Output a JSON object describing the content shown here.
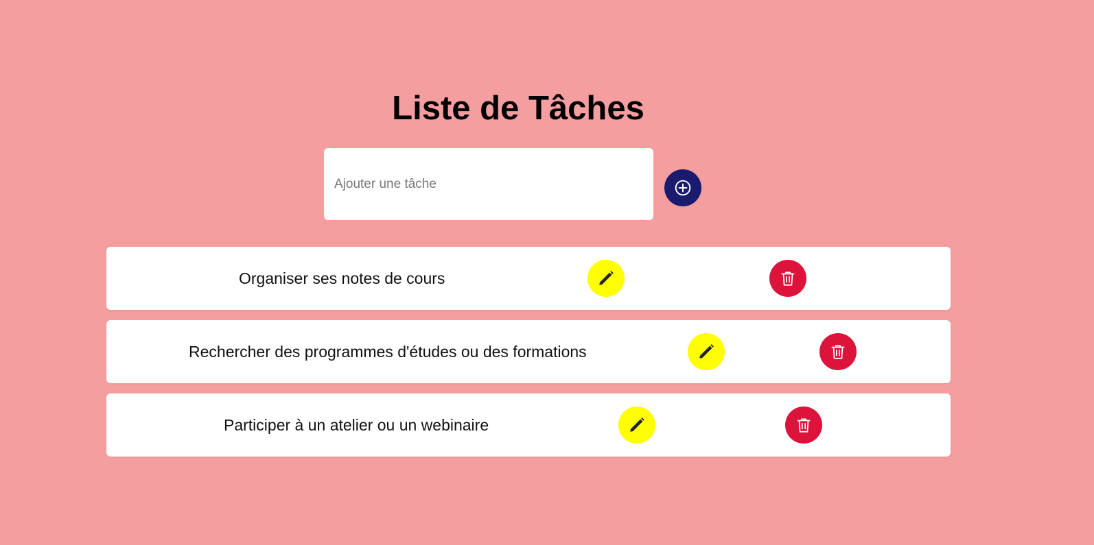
{
  "page": {
    "title": "Liste de Tâches",
    "background_color": "#f49e9f"
  },
  "new_task": {
    "placeholder": "Ajouter une tâche",
    "value": "",
    "add_icon": "plus-circle-icon",
    "add_button_color": "#1a1b6e"
  },
  "tasks": [
    {
      "text": "Organiser ses notes de cours",
      "edit_icon": "pencil-icon",
      "delete_icon": "trash-icon"
    },
    {
      "text": "Rechercher des programmes d'études ou des formations",
      "edit_icon": "pencil-icon",
      "delete_icon": "trash-icon"
    },
    {
      "text": "Participer à un atelier ou un webinaire",
      "edit_icon": "pencil-icon",
      "delete_icon": "trash-icon"
    }
  ],
  "colors": {
    "edit_button": "#ffff00",
    "delete_button": "#dc143c"
  }
}
